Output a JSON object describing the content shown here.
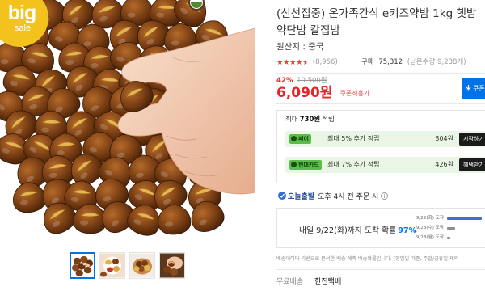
{
  "colors": {
    "price_red": "#e52528",
    "accent_blue": "#0073e9",
    "star_red": "#ef3e36",
    "badge_yellow": "#f4c21c",
    "reward_row_bg": "#eaf6e5"
  },
  "gallery": {
    "badge": {
      "line1": "big",
      "line2": "sale"
    },
    "main_image": "roasted-chestnuts-with-hand-photo",
    "thumbnails": [
      {
        "image": "chestnut-pile",
        "selected": true
      },
      {
        "image": "snack-assortment",
        "selected": false
      },
      {
        "image": "chestnut-bowl",
        "selected": false
      },
      {
        "image": "hand-with-chestnuts",
        "selected": false
      }
    ]
  },
  "product": {
    "title": "(신선집중) 온가족간식 e키즈약밤 1kg 햇밤 약단밤 칼집밤",
    "origin": "원산지 : 중국",
    "rating": {
      "score": 4.5,
      "max": 5,
      "star_glyphs": "★★★★★",
      "review_count": "(8,956)"
    },
    "purchase": {
      "label": "구매",
      "count": "75,312",
      "remaining": "(남은수량 9,238개)"
    },
    "price": {
      "discount_rate": "42%",
      "original": "10,500원",
      "sale": "6,090원",
      "coupon_label": "쿠폰적용가"
    },
    "coupon_button": {
      "label": "쿠폰",
      "icon": "download-icon"
    }
  },
  "rewards": {
    "head": {
      "prefix": "최대",
      "amount": "730원",
      "suffix": "적립"
    },
    "offers": [
      {
        "badge": "페이",
        "description": "최대 5% 추가 적립",
        "amount": "304원",
        "button": "시작하기"
      },
      {
        "badge": "현대카드",
        "description": "최대 7% 추가 적립",
        "amount": "426원",
        "button": "혜택받기"
      }
    ]
  },
  "shipping": {
    "today": {
      "badge": "오늘출발",
      "text": "오후 4시 전 주문 시",
      "icon": "today-shipping-icon"
    },
    "forecast": {
      "headline": "내일 9/22(화)까지 도착 확률",
      "probability": "97%",
      "bars": [
        {
          "label": "9/22(화) 도착",
          "fill": 0.97,
          "color": "#3d6fd0"
        },
        {
          "label": "9/23(수) 도착",
          "fill": 0.22,
          "color": "#8e8e8e"
        },
        {
          "label": "9/28(월) 도착",
          "fill": 0.09,
          "color": "#8e8e8e"
        }
      ]
    },
    "note": "배송데이터 기반으로 분석한 배송 예측 배송확률입니다. (영업일 기준, 주말/공휴일 제외",
    "fee": "무료배송",
    "carrier": "한진택배"
  }
}
